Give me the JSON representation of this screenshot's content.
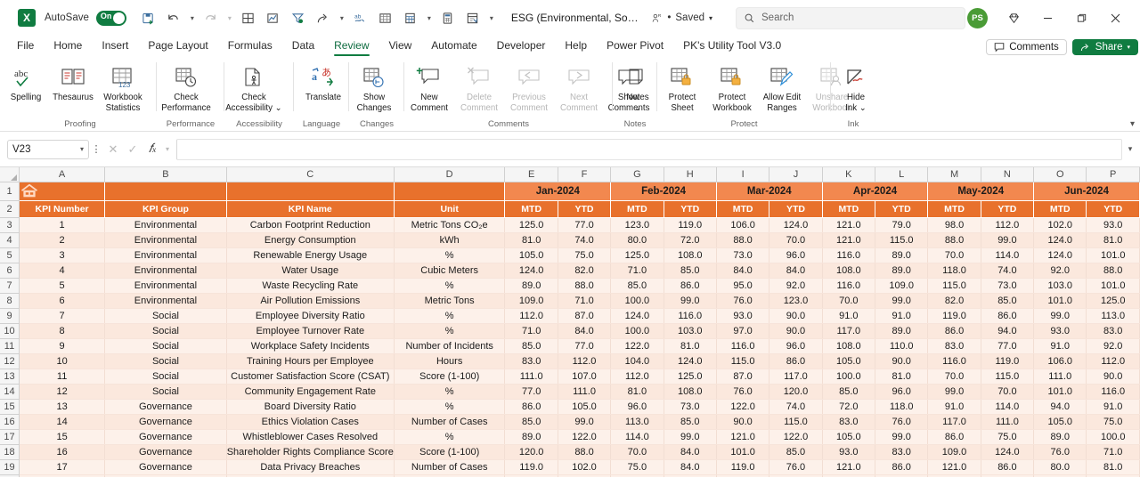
{
  "titlebar": {
    "app_logo": "excel-logo",
    "autosave_label": "AutoSave",
    "autosave_state": "On",
    "document_title": "ESG (Environmental, Social, and Governance) KPI Dash...",
    "saved_status": "Saved",
    "saved_separator": "•",
    "search_placeholder": "Search",
    "account_initials": "PS",
    "quick_access": [
      "save-icon",
      "undo-icon",
      "undo-caret",
      "redo-icon",
      "redo-caret",
      "borders-icon",
      "chart-icon",
      "filter-icon",
      "share-arrow-icon",
      "share-caret",
      "spelling-icon",
      "table-icon",
      "calculate-icon",
      "calculate-caret",
      "calculator-icon",
      "form-icon",
      "customize-caret"
    ],
    "window_buttons": [
      "diamond-icon",
      "minimize",
      "restore",
      "close"
    ]
  },
  "ribbon": {
    "tabs": [
      {
        "label": "File",
        "active": false
      },
      {
        "label": "Home",
        "active": false
      },
      {
        "label": "Insert",
        "active": false
      },
      {
        "label": "Page Layout",
        "active": false
      },
      {
        "label": "Formulas",
        "active": false
      },
      {
        "label": "Data",
        "active": false
      },
      {
        "label": "Review",
        "active": true
      },
      {
        "label": "View",
        "active": false
      },
      {
        "label": "Automate",
        "active": false
      },
      {
        "label": "Developer",
        "active": false
      },
      {
        "label": "Help",
        "active": false
      },
      {
        "label": "Power Pivot",
        "active": false
      },
      {
        "label": "PK's Utility Tool V3.0",
        "active": false
      }
    ],
    "comments_button": "Comments",
    "share_button": "Share",
    "collapse_icon": "chevron-up-icon",
    "groups": [
      {
        "label": "Proofing",
        "items": [
          {
            "label": "Spelling",
            "icon": "abc-check-icon",
            "disabled": false,
            "width": "w50"
          },
          {
            "label": "Thesaurus",
            "icon": "book-icon",
            "disabled": false,
            "width": ""
          },
          {
            "label": "Workbook\nStatistics",
            "line1": "Workbook",
            "line2": "Statistics",
            "icon": "workbook-stats-icon",
            "disabled": false,
            "width": ""
          }
        ]
      },
      {
        "label": "Performance",
        "items": [
          {
            "label": "Check\nPerformance",
            "line1": "Check",
            "line2": "Performance",
            "icon": "check-performance-icon",
            "disabled": false,
            "width": "w66"
          }
        ]
      },
      {
        "label": "Accessibility",
        "items": [
          {
            "label": "Check\nAccessibility",
            "line1": "Check",
            "line2": "Accessibility ⌄",
            "icon": "check-accessibility-icon",
            "disabled": false,
            "width": "w66"
          }
        ]
      },
      {
        "label": "Language",
        "items": [
          {
            "label": "Translate",
            "icon": "translate-icon",
            "disabled": false,
            "width": ""
          }
        ]
      },
      {
        "label": "Changes",
        "items": [
          {
            "label": "Show\nChanges",
            "line1": "Show",
            "line2": "Changes",
            "icon": "show-changes-icon",
            "disabled": false,
            "width": ""
          }
        ]
      },
      {
        "label": "Comments",
        "items": [
          {
            "label": "New\nComment",
            "line1": "New",
            "line2": "Comment",
            "icon": "new-comment-icon",
            "disabled": false,
            "width": ""
          },
          {
            "label": "Delete\nComment",
            "line1": "Delete",
            "line2": "Comment",
            "icon": "delete-comment-icon",
            "disabled": true,
            "width": ""
          },
          {
            "label": "Previous\nComment",
            "line1": "Previous",
            "line2": "Comment",
            "icon": "previous-comment-icon",
            "disabled": true,
            "width": ""
          },
          {
            "label": "Next\nComment",
            "line1": "Next",
            "line2": "Comment",
            "icon": "next-comment-icon",
            "disabled": true,
            "width": ""
          },
          {
            "label": "Show\nComments",
            "line1": "Show",
            "line2": "Comments",
            "icon": "show-comments-icon",
            "disabled": false,
            "width": ""
          }
        ]
      },
      {
        "label": "Notes",
        "items": [
          {
            "label": "Notes",
            "line1": "Notes",
            "line2": "⌄",
            "icon": "notes-icon",
            "disabled": false,
            "width": ""
          }
        ]
      },
      {
        "label": "Protect",
        "items": [
          {
            "label": "Protect\nSheet",
            "line1": "Protect",
            "line2": "Sheet",
            "icon": "protect-sheet-icon",
            "disabled": false,
            "width": ""
          },
          {
            "label": "Protect\nWorkbook",
            "line1": "Protect",
            "line2": "Workbook",
            "icon": "protect-workbook-icon",
            "disabled": false,
            "width": ""
          },
          {
            "label": "Allow Edit\nRanges",
            "line1": "Allow Edit",
            "line2": "Ranges",
            "icon": "allow-edit-ranges-icon",
            "disabled": false,
            "width": ""
          },
          {
            "label": "Unshare\nWorkbook",
            "line1": "Unshare",
            "line2": "Workbook",
            "icon": "unshare-workbook-icon",
            "disabled": true,
            "width": ""
          }
        ]
      },
      {
        "label": "Ink",
        "items": [
          {
            "label": "Hide\nInk",
            "line1": "Hide",
            "line2": "Ink ⌄",
            "icon": "hide-ink-icon",
            "disabled": false,
            "width": ""
          }
        ]
      }
    ]
  },
  "formula_bar": {
    "name_box_value": "V23",
    "name_box_caret": "chevron-down-icon",
    "more_options": "vertical-ellipsis-icon",
    "cancel_icon": "cancel-x-icon",
    "enter_icon": "enter-check-icon",
    "function_icon": "fx-icon",
    "function_caret": "chevron-down-icon",
    "formula_value": "",
    "expand_icon": "chevron-down-icon"
  },
  "grid": {
    "column_letters": [
      "A",
      "B",
      "C",
      "D",
      "E",
      "F",
      "G",
      "H",
      "I",
      "J",
      "K",
      "L",
      "M",
      "N",
      "O",
      "P"
    ],
    "row_numbers": [
      "1",
      "2",
      "3",
      "4",
      "5",
      "6",
      "7",
      "8",
      "9",
      "10",
      "11",
      "12",
      "13",
      "14",
      "15",
      "16",
      "17",
      "18",
      "19"
    ],
    "home_icon": "home-icon",
    "month_headers": [
      "Jan-2024",
      "Feb-2024",
      "Mar-2024",
      "Apr-2024",
      "May-2024",
      "Jun-2024"
    ],
    "period_subheaders": [
      "MTD",
      "YTD"
    ],
    "left_headers": [
      "KPI Number",
      "KPI Group",
      "KPI Name",
      "Unit"
    ],
    "colors": {
      "header_dark": "#e8712c",
      "header_light": "#f2884f",
      "band_a": "#fdf1ea",
      "band_b": "#fbe8dd",
      "accent_green": "#107c41"
    }
  },
  "chart_data": {
    "type": "table",
    "title": "ESG (Environmental, Social, and Governance) KPI Dashboard",
    "columns": [
      "KPI Number",
      "KPI Group",
      "KPI Name",
      "Unit",
      "Jan-2024 MTD",
      "Jan-2024 YTD",
      "Feb-2024 MTD",
      "Feb-2024 YTD",
      "Mar-2024 MTD",
      "Mar-2024 YTD",
      "Apr-2024 MTD",
      "Apr-2024 YTD",
      "May-2024 MTD",
      "May-2024 YTD",
      "Jun-2024 MTD",
      "Jun-2024 YTD"
    ],
    "rows": [
      {
        "excel_row": "3",
        "kpi_number": "1",
        "kpi_group": "Environmental",
        "kpi_name": "Carbon Footprint Reduction",
        "unit": "Metric Tons CO₂e",
        "values": [
          "125.0",
          "77.0",
          "123.0",
          "119.0",
          "106.0",
          "124.0",
          "121.0",
          "79.0",
          "98.0",
          "112.0",
          "102.0",
          "93.0"
        ]
      },
      {
        "excel_row": "4",
        "kpi_number": "2",
        "kpi_group": "Environmental",
        "kpi_name": "Energy Consumption",
        "unit": "kWh",
        "values": [
          "81.0",
          "74.0",
          "80.0",
          "72.0",
          "88.0",
          "70.0",
          "121.0",
          "115.0",
          "88.0",
          "99.0",
          "124.0",
          "81.0"
        ]
      },
      {
        "excel_row": "5",
        "kpi_number": "3",
        "kpi_group": "Environmental",
        "kpi_name": "Renewable Energy Usage",
        "unit": "%",
        "values": [
          "105.0",
          "75.0",
          "125.0",
          "108.0",
          "73.0",
          "96.0",
          "116.0",
          "89.0",
          "70.0",
          "114.0",
          "124.0",
          "101.0"
        ]
      },
      {
        "excel_row": "6",
        "kpi_number": "4",
        "kpi_group": "Environmental",
        "kpi_name": "Water Usage",
        "unit": "Cubic Meters",
        "values": [
          "124.0",
          "82.0",
          "71.0",
          "85.0",
          "84.0",
          "84.0",
          "108.0",
          "89.0",
          "118.0",
          "74.0",
          "92.0",
          "88.0"
        ]
      },
      {
        "excel_row": "7",
        "kpi_number": "5",
        "kpi_group": "Environmental",
        "kpi_name": "Waste Recycling Rate",
        "unit": "%",
        "values": [
          "89.0",
          "88.0",
          "85.0",
          "86.0",
          "95.0",
          "92.0",
          "116.0",
          "109.0",
          "115.0",
          "73.0",
          "103.0",
          "101.0"
        ]
      },
      {
        "excel_row": "8",
        "kpi_number": "6",
        "kpi_group": "Environmental",
        "kpi_name": "Air Pollution Emissions",
        "unit": "Metric Tons",
        "values": [
          "109.0",
          "71.0",
          "100.0",
          "99.0",
          "76.0",
          "123.0",
          "70.0",
          "99.0",
          "82.0",
          "85.0",
          "101.0",
          "125.0"
        ]
      },
      {
        "excel_row": "9",
        "kpi_number": "7",
        "kpi_group": "Social",
        "kpi_name": "Employee Diversity Ratio",
        "unit": "%",
        "values": [
          "112.0",
          "87.0",
          "124.0",
          "116.0",
          "93.0",
          "90.0",
          "91.0",
          "91.0",
          "119.0",
          "86.0",
          "99.0",
          "113.0"
        ]
      },
      {
        "excel_row": "10",
        "kpi_number": "8",
        "kpi_group": "Social",
        "kpi_name": "Employee Turnover Rate",
        "unit": "%",
        "values": [
          "71.0",
          "84.0",
          "100.0",
          "103.0",
          "97.0",
          "90.0",
          "117.0",
          "89.0",
          "86.0",
          "94.0",
          "93.0",
          "83.0"
        ]
      },
      {
        "excel_row": "11",
        "kpi_number": "9",
        "kpi_group": "Social",
        "kpi_name": "Workplace Safety Incidents",
        "unit": "Number of Incidents",
        "values": [
          "85.0",
          "77.0",
          "122.0",
          "81.0",
          "116.0",
          "96.0",
          "108.0",
          "110.0",
          "83.0",
          "77.0",
          "91.0",
          "92.0"
        ]
      },
      {
        "excel_row": "12",
        "kpi_number": "10",
        "kpi_group": "Social",
        "kpi_name": "Training Hours per Employee",
        "unit": "Hours",
        "values": [
          "83.0",
          "112.0",
          "104.0",
          "124.0",
          "115.0",
          "86.0",
          "105.0",
          "90.0",
          "116.0",
          "119.0",
          "106.0",
          "112.0"
        ]
      },
      {
        "excel_row": "13",
        "kpi_number": "11",
        "kpi_group": "Social",
        "kpi_name": "Customer Satisfaction Score (CSAT)",
        "unit": "Score (1-100)",
        "values": [
          "111.0",
          "107.0",
          "112.0",
          "125.0",
          "87.0",
          "117.0",
          "100.0",
          "81.0",
          "70.0",
          "115.0",
          "111.0",
          "90.0"
        ]
      },
      {
        "excel_row": "14",
        "kpi_number": "12",
        "kpi_group": "Social",
        "kpi_name": "Community Engagement Rate",
        "unit": "%",
        "values": [
          "77.0",
          "111.0",
          "81.0",
          "108.0",
          "76.0",
          "120.0",
          "85.0",
          "96.0",
          "99.0",
          "70.0",
          "101.0",
          "116.0"
        ]
      },
      {
        "excel_row": "15",
        "kpi_number": "13",
        "kpi_group": "Governance",
        "kpi_name": "Board Diversity Ratio",
        "unit": "%",
        "values": [
          "86.0",
          "105.0",
          "96.0",
          "73.0",
          "122.0",
          "74.0",
          "72.0",
          "118.0",
          "91.0",
          "114.0",
          "94.0",
          "91.0"
        ]
      },
      {
        "excel_row": "16",
        "kpi_number": "14",
        "kpi_group": "Governance",
        "kpi_name": "Ethics Violation Cases",
        "unit": "Number of Cases",
        "values": [
          "85.0",
          "99.0",
          "113.0",
          "85.0",
          "90.0",
          "115.0",
          "83.0",
          "76.0",
          "117.0",
          "111.0",
          "105.0",
          "75.0"
        ]
      },
      {
        "excel_row": "17",
        "kpi_number": "15",
        "kpi_group": "Governance",
        "kpi_name": "Whistleblower Cases Resolved",
        "unit": "%",
        "values": [
          "89.0",
          "122.0",
          "114.0",
          "99.0",
          "121.0",
          "122.0",
          "105.0",
          "99.0",
          "86.0",
          "75.0",
          "89.0",
          "100.0"
        ]
      },
      {
        "excel_row": "18",
        "kpi_number": "16",
        "kpi_group": "Governance",
        "kpi_name": "Shareholder Rights Compliance Score",
        "unit": "Score (1-100)",
        "values": [
          "120.0",
          "88.0",
          "70.0",
          "84.0",
          "101.0",
          "85.0",
          "93.0",
          "83.0",
          "109.0",
          "124.0",
          "76.0",
          "71.0"
        ]
      },
      {
        "excel_row": "19",
        "kpi_number": "17",
        "kpi_group": "Governance",
        "kpi_name": "Data Privacy Breaches",
        "unit": "Number of Cases",
        "values": [
          "119.0",
          "102.0",
          "75.0",
          "84.0",
          "119.0",
          "76.0",
          "121.0",
          "86.0",
          "121.0",
          "86.0",
          "80.0",
          "81.0"
        ]
      }
    ]
  }
}
